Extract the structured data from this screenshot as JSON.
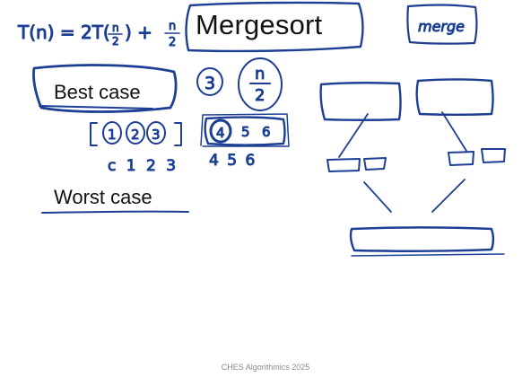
{
  "slide": {
    "title": "Mergesort",
    "best_case": "Best case",
    "worst_case": "Worst case",
    "footer": "CHES Algorithmics 2025"
  },
  "handwriting": {
    "recurrence_lhs": "T(n) = 2T(",
    "recurrence_frac_num": "n",
    "recurrence_frac_den": "2",
    "recurrence_tail": ") +",
    "recurrence_plus_num": "n",
    "recurrence_plus_den": "2",
    "merge_label": "merge",
    "circled_three": "3",
    "n_over_two_num": "n",
    "n_over_two_den": "2",
    "left_block": [
      "1",
      "2",
      "3"
    ],
    "right_block": [
      "4",
      "5",
      "6"
    ],
    "left_indices": "c 1 2 3",
    "right_indices": "4 5 6"
  },
  "colors": {
    "ink": "#1c3f94",
    "text": "#111111",
    "footer": "#8a8a8a",
    "background": "#ffffff"
  }
}
